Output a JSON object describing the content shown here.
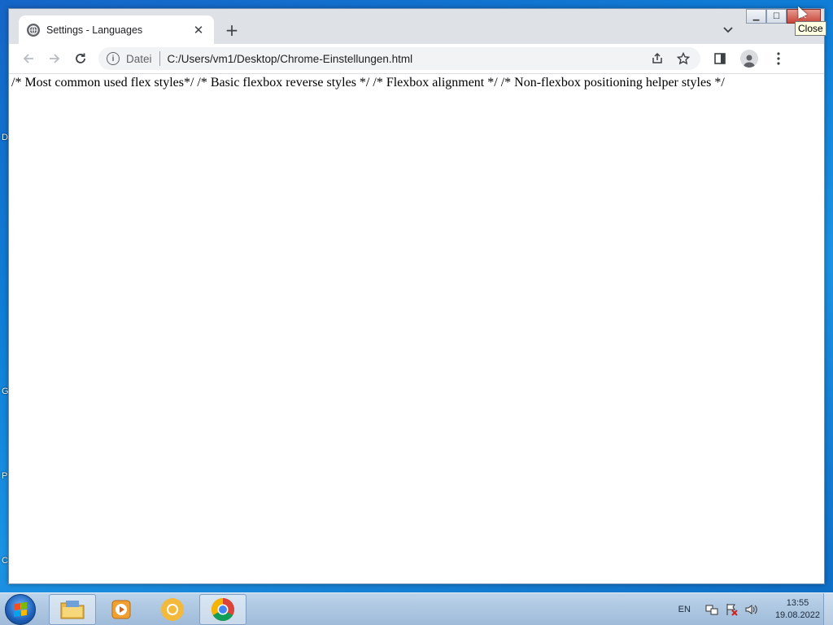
{
  "desktop": {
    "edge_glyphs": [
      "D",
      "G",
      "P",
      "C"
    ]
  },
  "window": {
    "tab": {
      "title": "Settings - Languages"
    },
    "caption": {
      "minimize": "▁",
      "maximize": "☐",
      "close": "✕",
      "close_tooltip": "Close"
    }
  },
  "toolbar": {
    "scheme_label": "Datei",
    "url": "C:/Users/vm1/Desktop/Chrome-Einstellungen.html"
  },
  "page": {
    "content_text": "/* Most common used flex styles*/ /* Basic flexbox reverse styles */ /* Flexbox alignment */ /* Non-flexbox positioning helper styles */"
  },
  "taskbar": {
    "apps": [
      "file-explorer-icon",
      "media-player-icon",
      "chromium-icon",
      "chrome-icon"
    ],
    "language": "EN",
    "clock": {
      "time": "13:55",
      "date": "19.08.2022"
    }
  },
  "colors": {
    "close_button": "#c6453a",
    "chrome_red": "#db4437",
    "chrome_yellow": "#f4b400",
    "chrome_green": "#0f9d58",
    "chrome_blue": "#4285f4"
  }
}
